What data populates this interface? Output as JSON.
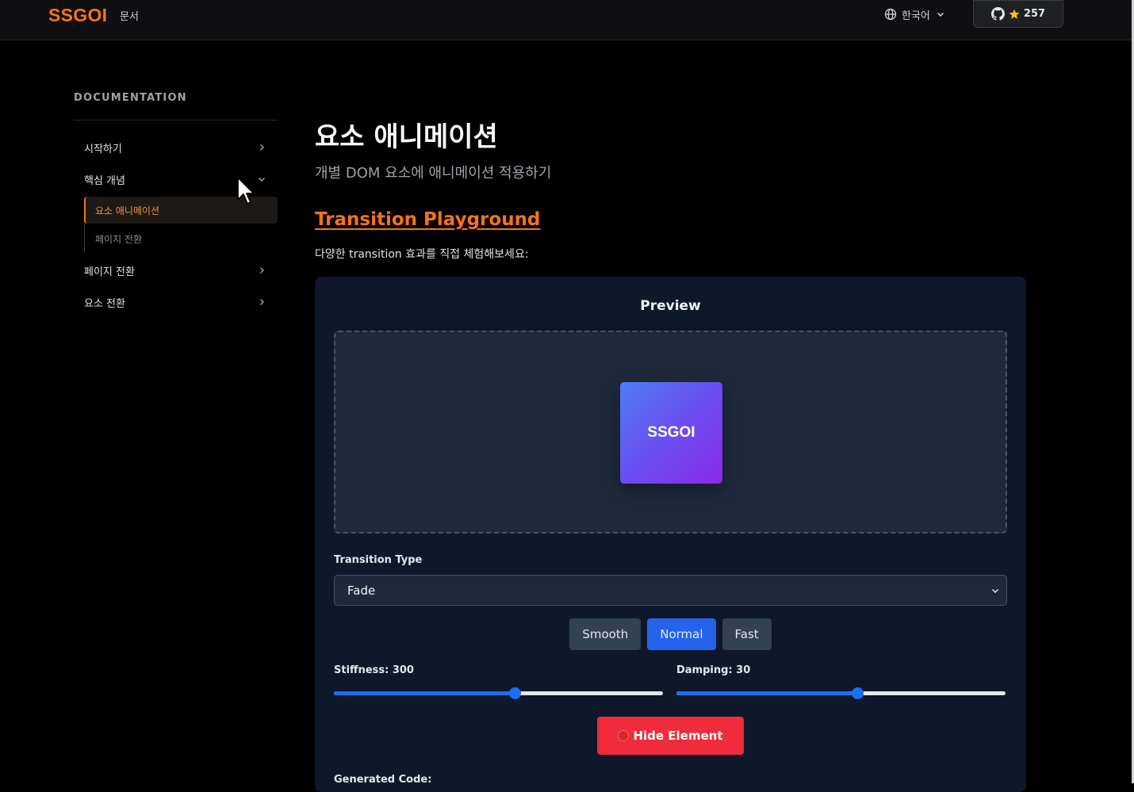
{
  "header": {
    "logo": "SSGOI",
    "nav_docs": "문서",
    "language": "한국어",
    "github_stars": "257"
  },
  "sidebar": {
    "heading": "DOCUMENTATION",
    "items": [
      {
        "label": "시작하기",
        "state": "collapsed"
      },
      {
        "label": "핵심 개념",
        "state": "expanded"
      },
      {
        "label": "페이지 전환",
        "state": "collapsed"
      },
      {
        "label": "요소 전환",
        "state": "collapsed"
      }
    ],
    "subitems": [
      {
        "label": "요소 애니메이션",
        "active": true
      },
      {
        "label": "페이지 전환",
        "active": false
      }
    ]
  },
  "main": {
    "title": "요소 애니메이션",
    "subtitle": "개별 DOM 요소에 애니메이션 적용하기",
    "section_title": "Transition Playground",
    "section_desc": "다양한 transition 효과를 직접 체험해보세요:"
  },
  "playground": {
    "preview_title": "Preview",
    "demo_label": "SSGOI",
    "transition_type_label": "Transition Type",
    "transition_type_value": "Fade",
    "presets": [
      {
        "label": "Smooth",
        "active": false
      },
      {
        "label": "Normal",
        "active": true
      },
      {
        "label": "Fast",
        "active": false
      }
    ],
    "stiffness_label": "Stiffness: 300",
    "stiffness_fraction": 0.55,
    "damping_label": "Damping: 30",
    "damping_fraction": 0.55,
    "hide_button": "Hide Element",
    "generated_code_label": "Generated Code:"
  },
  "colors": {
    "accent": "#f97316",
    "primary_blue": "#2563eb",
    "danger": "#ef2b3c"
  }
}
